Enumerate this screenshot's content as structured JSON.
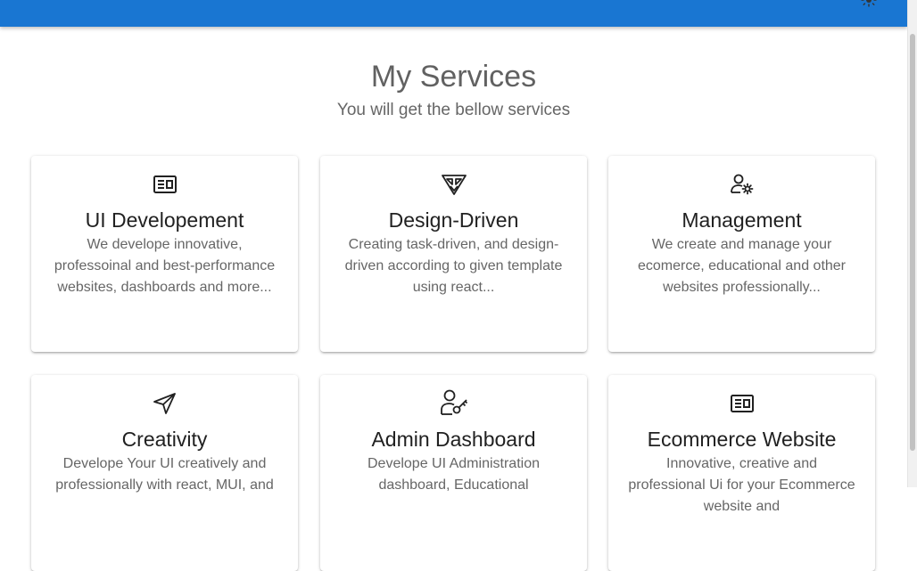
{
  "header": {
    "theme_toggle_icon": "sun-icon",
    "accent_color": "#1976d2"
  },
  "services": {
    "title": "My Services",
    "subtitle": "You will get the bellow services",
    "cards": [
      {
        "icon": "newspaper-icon",
        "title": "UI Developement",
        "description": "We develope innovative, professoinal and best-performance websites, dashboards and more..."
      },
      {
        "icon": "emblem-icon",
        "title": "Design-Driven",
        "description": "Creating task-driven, and design-driven according to given template using react..."
      },
      {
        "icon": "user-settings-icon",
        "title": "Management",
        "description": "We create and manage your ecomerce, educational and other websites professionally..."
      },
      {
        "icon": "paper-plane-icon",
        "title": "Creativity",
        "description": "Develope Your UI creatively and professionally with react, MUI, and"
      },
      {
        "icon": "user-key-icon",
        "title": "Admin Dashboard",
        "description": "Develope UI Administration dashboard, Educational"
      },
      {
        "icon": "newspaper-icon",
        "title": "Ecommerce Website",
        "description": "Innovative, creative and professional Ui for your Ecommerce website and"
      }
    ]
  }
}
